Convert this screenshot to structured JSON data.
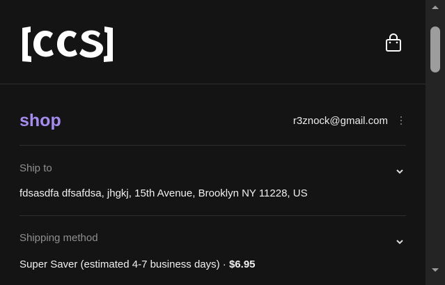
{
  "header": {
    "logo_text": "[CCS]",
    "cart_icon": "shopping-bag-icon"
  },
  "account": {
    "shop_label": "shop",
    "email": "r3znock@gmail.com",
    "menu_icon": "kebab-menu-icon"
  },
  "ship_to": {
    "label": "Ship to",
    "value": "fdsasdfa dfsafdsa, jhgkj, 15th Avenue, Brooklyn NY 11228, US"
  },
  "shipping_method": {
    "label": "Shipping method",
    "value": "Super Saver (estimated 4-7 business days) · ",
    "price": "$6.95"
  },
  "colors": {
    "background": "#141414",
    "shop_accent": "#a68cf0",
    "text": "#f0f0f0",
    "muted": "#8f8f8f"
  }
}
